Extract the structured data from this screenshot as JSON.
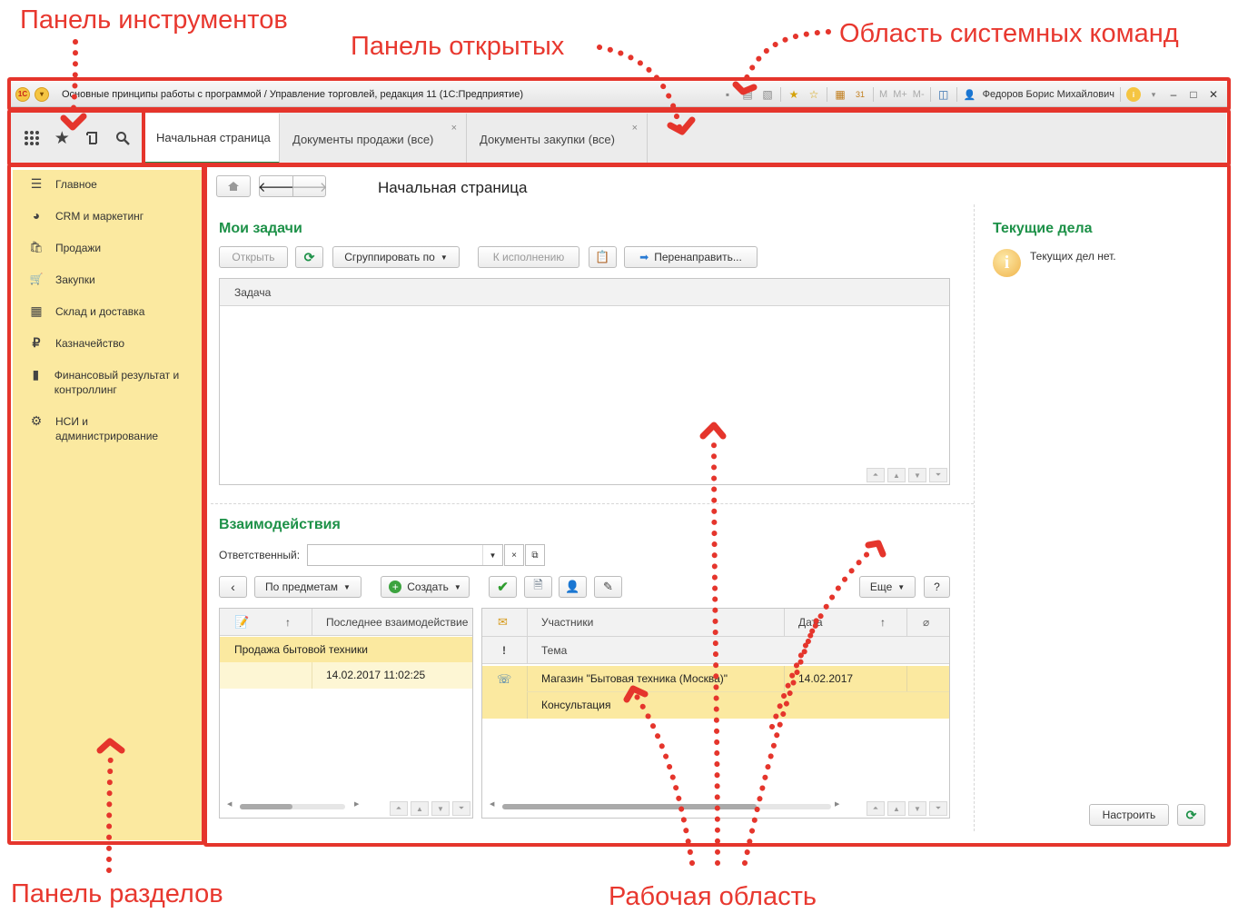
{
  "annotations": {
    "toolbar_panel": "Панель инструментов",
    "open_panel": "Панель открытых",
    "system_commands": "Область системных команд",
    "sections_panel": "Панель разделов",
    "work_area": "Рабочая область"
  },
  "titlebar": {
    "logo_text": "1С",
    "title": "Основные принципы работы с программой / Управление торговлей, редакция 11  (1С:Предприятие)",
    "memory_buttons": [
      "M",
      "M+",
      "M-"
    ],
    "user": "Федоров Борис Михайлович",
    "window_controls": [
      "–",
      "□",
      "✕"
    ]
  },
  "toolbar": {
    "icons": [
      "apps-grid-icon",
      "favorites-star-icon",
      "history-icon",
      "search-icon"
    ]
  },
  "tabs": [
    {
      "label": "Начальная страница",
      "active": true,
      "closable": false
    },
    {
      "label": "Документы продажи (все)",
      "active": false,
      "closable": true
    },
    {
      "label": "Документы закупки (все)",
      "active": false,
      "closable": true
    }
  ],
  "sections": [
    {
      "icon": "menu-lines-icon",
      "glyph": "☰",
      "label": "Главное"
    },
    {
      "icon": "pie-chart-icon",
      "glyph": "◕",
      "label": "CRM и маркетинг"
    },
    {
      "icon": "shopping-bag-icon",
      "glyph": "🛍",
      "label": "Продажи"
    },
    {
      "icon": "cart-icon",
      "glyph": "🛒",
      "label": "Закупки"
    },
    {
      "icon": "warehouse-grid-icon",
      "glyph": "▦",
      "label": "Склад и доставка"
    },
    {
      "icon": "ruble-coin-icon",
      "glyph": "₽",
      "label": "Казначейство"
    },
    {
      "icon": "bar-chart-icon",
      "glyph": "▮",
      "label": "Финансовый результат и контроллинг"
    },
    {
      "icon": "gear-icon",
      "glyph": "⚙",
      "label": "НСИ и администрирование"
    }
  ],
  "work": {
    "page_title": "Начальная страница",
    "my_tasks": {
      "heading": "Мои задачи",
      "buttons": {
        "open": "Открыть",
        "group_by": "Сгруппировать по",
        "to_execution": "К исполнению",
        "redirect": "Перенаправить..."
      },
      "column": "Задача"
    },
    "interactions": {
      "heading": "Взаимодействия",
      "responsible_label": "Ответственный:",
      "responsible_value": "",
      "buttons": {
        "by_subjects": "По предметам",
        "create": "Создать",
        "more": "Еще",
        "help": "?"
      },
      "left_grid": {
        "sort_arrow": "↑",
        "column": "Последнее взаимодействие",
        "group": "Продажа бытовой техники",
        "date": "14.02.2017 11:02:25"
      },
      "right_grid": {
        "col_participants": "Участники",
        "col_date": "Дата",
        "sort_arrow": "↑",
        "col_subject": "Тема",
        "exclaim": "!",
        "row_participant": "Магазин \"Бытовая техника (Москва)\"",
        "row_date": "14.02.2017",
        "row_subject": "Консультация"
      }
    },
    "current_tasks": {
      "heading": "Текущие дела",
      "empty": "Текущих дел нет.",
      "configure": "Настроить"
    }
  },
  "colors": {
    "annotation_red": "#e5352c",
    "accent_green": "#1d9148",
    "sections_bg": "#fbe9a0"
  }
}
